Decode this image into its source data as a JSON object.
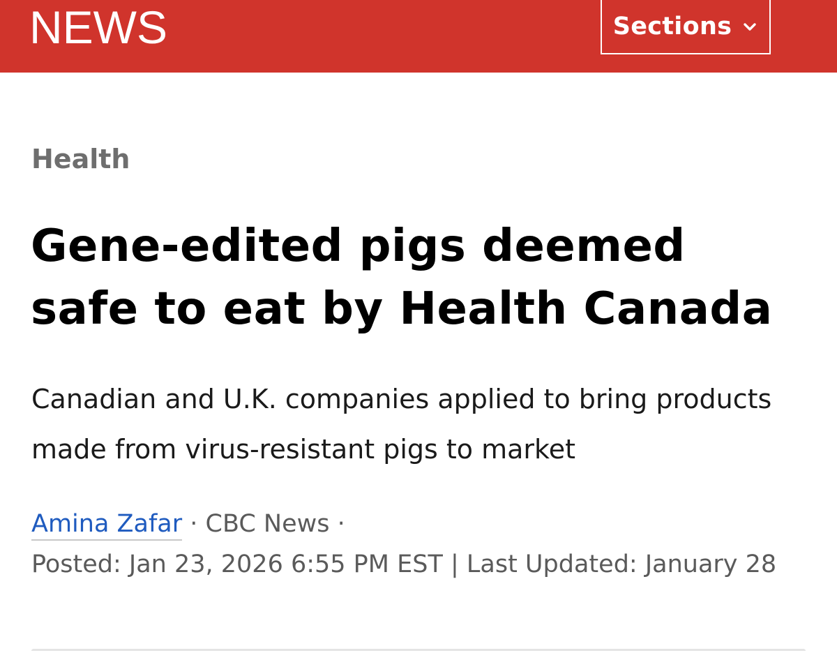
{
  "header": {
    "logo_text": "NEWS",
    "sections_label": "Sections",
    "brand_color": "#d0342c"
  },
  "article": {
    "category": "Health",
    "headline": "Gene-edited pigs deemed safe to eat by Health Canada",
    "deck": "Canadian and U.K. companies applied to bring products made from virus-resistant pigs to market",
    "author": "Amina Zafar",
    "source": "CBC News",
    "separator": "·",
    "posted": "Posted: Jan 23, 2026 6:55 PM EST",
    "divider": "|",
    "updated": "Last Updated: January 28"
  },
  "icons": {
    "sections": "chevron-down-icon"
  }
}
